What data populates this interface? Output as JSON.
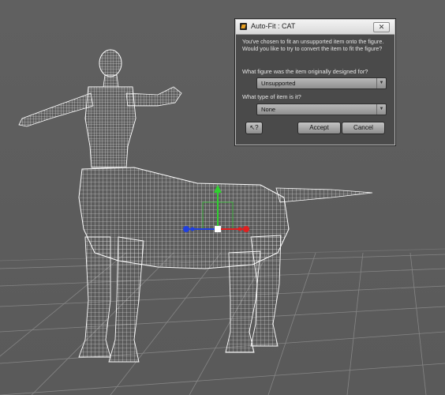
{
  "dialog": {
    "title": "Auto-Fit : CAT",
    "close_label": "✕",
    "message_line1": "You've chosen to fit an unsupported item onto the figure.",
    "message_line2": "Would you like to try to convert the item to fit the figure?",
    "figure_question": "What figure was the item originally designed for?",
    "figure_value": "Unsupported",
    "type_question": "What type of item is it?",
    "type_value": "None",
    "help_label": "↖?",
    "accept_label": "Accept",
    "cancel_label": "Cancel"
  },
  "colors": {
    "viewport_bg": "#5d5d5d",
    "dialog_bg": "#4a4a4a",
    "wireframe": "#ffffff",
    "gizmo_x": "#e02020",
    "gizmo_y": "#20c020",
    "gizmo_z": "#2040e0"
  },
  "icons": [
    "app-icon",
    "close-icon",
    "help-pointer-icon",
    "dropdown-arrow-icon"
  ]
}
